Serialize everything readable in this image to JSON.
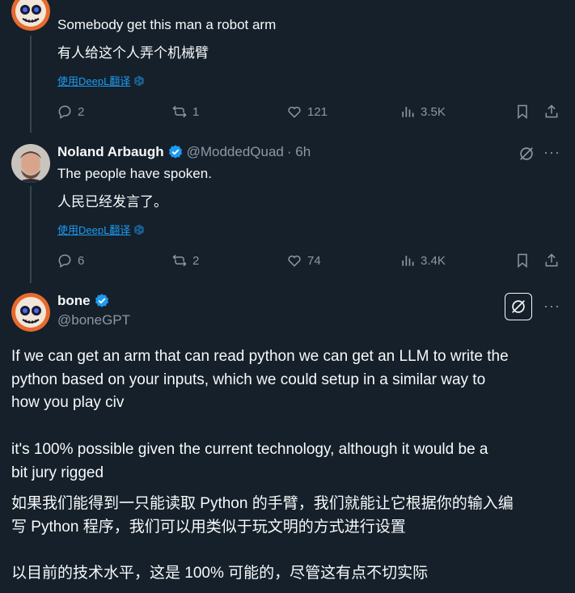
{
  "tweet1": {
    "text": "Somebody get this man a robot arm",
    "translation": "有人给这个人弄个机械臂",
    "translate_link": "使用DeepL翻译",
    "replies": "2",
    "reposts": "1",
    "likes": "121",
    "views": "3.5K"
  },
  "tweet2": {
    "name": "Noland Arbaugh",
    "handle": "@ModdedQuad",
    "time": "· 6h",
    "text": "The people have spoken.",
    "translation": "人民已经发言了。",
    "translate_link": "使用DeepL翻译",
    "replies": "6",
    "reposts": "2",
    "likes": "74",
    "views": "3.4K"
  },
  "main_tweet": {
    "name": "bone",
    "handle": "@boneGPT",
    "paragraph1_line1": "If we can get an arm that can read python we can get an LLM to write the",
    "paragraph1_line2": "python based on your inputs, which we could setup in a similar way to",
    "paragraph1_line3": "how you play civ",
    "paragraph2_line1": "it's 100% possible given the current technology, although it would be a",
    "paragraph2_line2": "bit jury rigged",
    "translation1_line1": "如果我们能得到一只能读取 Python 的手臂，我们就能让它根据你的输入编",
    "translation1_line2": "写 Python 程序，我们可以用类似于玩文明的方式进行设置",
    "translation2_line1": "以目前的技术水平，这是 100% 可能的，尽管这有点不切实际"
  },
  "colors": {
    "background": "#15202b",
    "text": "#f7f9f9",
    "muted": "#8b98a5",
    "accent": "#1d9bf0"
  }
}
